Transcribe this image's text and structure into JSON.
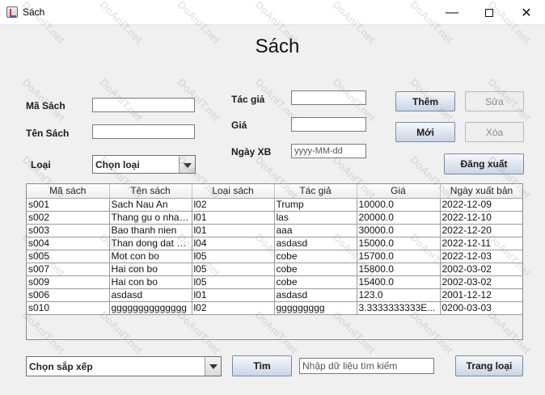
{
  "window": {
    "title": "Sách",
    "min_glyph": "—",
    "close_glyph": "✕"
  },
  "header": {
    "title": "Sách"
  },
  "form": {
    "ma_sach_label": "Mã Sách",
    "ma_sach_value": "",
    "ten_sach_label": "Tên Sách",
    "ten_sach_value": "",
    "loai_label": "Loại",
    "loai_selected": "Chọn loại",
    "tac_gia_label": "Tác giả",
    "tac_gia_value": "",
    "gia_label": "Giá",
    "gia_value": "",
    "ngay_xb_label": "Ngày XB",
    "ngay_xb_placeholder": "yyyy-MM-dd"
  },
  "buttons": {
    "them": "Thêm",
    "sua": "Sửa",
    "moi": "Mới",
    "xoa": "Xóa",
    "dang_xuat": "Đăng xuất",
    "tim": "Tìm",
    "trang_loai": "Trang loại"
  },
  "table": {
    "columns": [
      "Mã sách",
      "Tên sách",
      "Loại sách",
      "Tác giả",
      "Giá",
      "Ngày xuất bản"
    ],
    "rows": [
      [
        "s001",
        "Sach Nau An",
        "l02",
        "Trump",
        "10000.0",
        "2022-12-09"
      ],
      [
        "s002",
        "Thang gu o nha ...",
        "l01",
        "las",
        "20000.0",
        "2022-12-10"
      ],
      [
        "s003",
        "Bao thanh nien",
        "l01",
        "aaa",
        "30000.0",
        "2022-12-20"
      ],
      [
        "s004",
        "Than dong dat vi...",
        "l04",
        "asdasd",
        "15000.0",
        "2022-12-11"
      ],
      [
        "s005",
        "Mot con bo",
        "l05",
        "cobe",
        "15700.0",
        "2022-12-03"
      ],
      [
        "s007",
        "Hai con bo",
        "l05",
        "cobe",
        "15800.0",
        "2002-03-02"
      ],
      [
        "s009",
        "Hai con bo",
        "l05",
        "cobe",
        "15400.0",
        "2002-03-02"
      ],
      [
        "s006",
        "asdasd",
        "l01",
        "asdasd",
        "123.0",
        "2001-12-12"
      ],
      [
        "s010",
        "gggggggggggggg",
        "l02",
        "ggggggggg",
        "3.3333333333E...",
        "0200-03-03"
      ]
    ]
  },
  "bottom": {
    "sort_selected": "Chọn sắp xếp",
    "search_placeholder": "Nhập dữ liệu tìm kiếm"
  },
  "watermark_text": "DoAnIT.net"
}
